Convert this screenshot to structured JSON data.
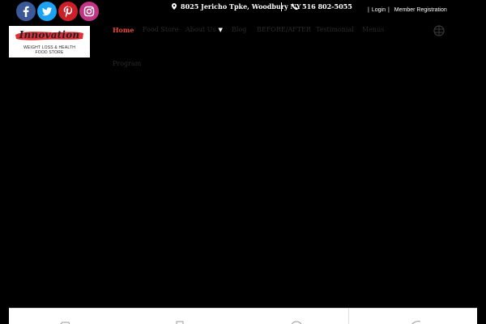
{
  "social": [
    {
      "name": "facebook",
      "icon": "facebook-icon",
      "color": "#3b5998"
    },
    {
      "name": "twitter",
      "icon": "twitter-icon",
      "color": "#1da1f2"
    },
    {
      "name": "pinterest",
      "icon": "pinterest-icon",
      "color": "#cb2027"
    },
    {
      "name": "instagram",
      "icon": "instagram-icon",
      "color": "#c13584"
    }
  ],
  "contact": {
    "address": "8025 Jericho Tpke, Woodbury NY",
    "phone": "516 802-5055"
  },
  "account": {
    "login": "Login",
    "register": "Member Registration",
    "separator": "|"
  },
  "logo": {
    "script": "Innovation",
    "tagline_1": "WEIGHT LOSS & HEALTH",
    "tagline_2": "FOOD STORE",
    "brush_color": "#e0303a"
  },
  "nav": {
    "items": [
      {
        "label": "Home",
        "active": true
      },
      {
        "label": "Food Store"
      },
      {
        "label": "About Us"
      },
      {
        "label": "Blog"
      },
      {
        "label": "BEFORE/AFTER"
      },
      {
        "label": "Testimonial"
      },
      {
        "label": "Menus"
      },
      {
        "label": "Program"
      }
    ],
    "active_color": "#e8493f"
  },
  "colors": {
    "background": "#000000",
    "panel": "#ffffff"
  }
}
